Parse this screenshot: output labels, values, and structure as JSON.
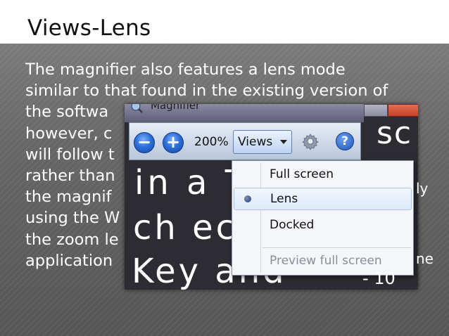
{
  "slide": {
    "title": "Views-Lens",
    "body_lines": [
      "The magnifier also features a lens mode",
      "similar to that found in the existing version of",
      "the softwa",
      "however, c",
      "will follow t",
      "rather than",
      "the magnif",
      "using the W",
      "the zoom le",
      "application"
    ]
  },
  "magnifier": {
    "window_title": "Magnifier",
    "toolbar": {
      "zoom_out_symbol": "−",
      "zoom_in_symbol": "+",
      "zoom_level": "200%",
      "views_label": "Views",
      "help_symbol": "?"
    },
    "magnified_text": {
      "line1": "in a T",
      "line2": "ch ec",
      "line3": "Key and",
      "right_sc": "sc",
      "right_ly": "ly",
      "right_ne": "ne",
      "tail": "- 10"
    },
    "views_menu": {
      "items": [
        {
          "label": "Full screen",
          "selected": false,
          "enabled": true
        },
        {
          "label": "Lens",
          "selected": true,
          "enabled": true
        },
        {
          "label": "Docked",
          "selected": false,
          "enabled": true
        }
      ],
      "disabled_item": {
        "label": "Preview full screen",
        "enabled": false
      }
    }
  },
  "colors": {
    "panel_gray": "#666666",
    "title_text": "#111111",
    "body_text": "#ffffff",
    "menu_highlight": "#dde9f9",
    "accent_blue": "#2d6fd8"
  },
  "icons": [
    "magnifier-app-icon",
    "zoom-out-icon",
    "zoom-in-icon",
    "dropdown-arrow-icon",
    "gear-icon",
    "help-icon",
    "radio-dot-icon"
  ]
}
